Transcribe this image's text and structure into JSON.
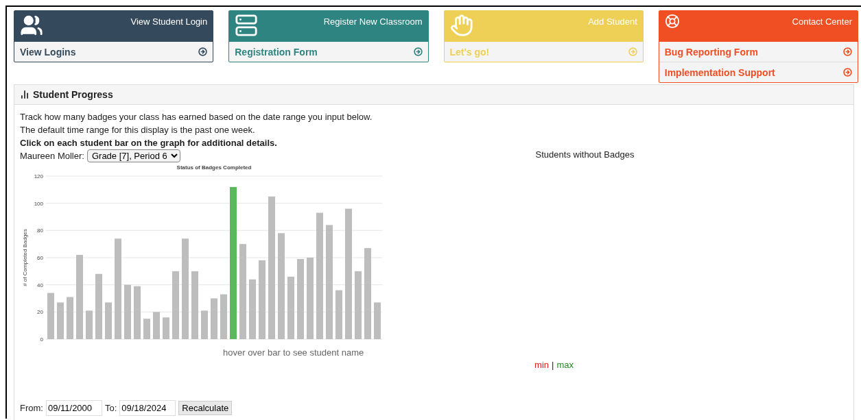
{
  "cards": [
    {
      "title": "View Student Login",
      "color": "#344a5c",
      "links": [
        "View Logins"
      ]
    },
    {
      "title": "Register New Classroom",
      "color": "#2e8480",
      "links": [
        "Registration Form"
      ]
    },
    {
      "title": "Add Student",
      "color": "#eed056",
      "links": [
        "Let's go!"
      ]
    },
    {
      "title": "Contact Center",
      "color": "#f04e23",
      "links": [
        "Bug Reporting Form",
        "Implementation Support"
      ]
    }
  ],
  "panel": {
    "title": "Student Progress",
    "intro": [
      "Track how many badges your class has earned based on the date range you input below.",
      "The default time range for this display is the past one week."
    ],
    "instruction": "Click on each student bar on the graph for additional details.",
    "teacher_label": "Maureen Moller:",
    "class_select": "Grade [7], Period 6",
    "chart_data": {
      "type": "bar",
      "title": "Status of Badges Completed",
      "ylabel": "# of Completed Badges",
      "ylim": [
        0,
        120
      ],
      "yticks": [
        0,
        20,
        40,
        60,
        80,
        100,
        120
      ],
      "grid": true,
      "series": [
        {
          "color": "#bdbdbd",
          "values": [
            34,
            27,
            31,
            62,
            21,
            48,
            27,
            74,
            40,
            39,
            15,
            20,
            16,
            50,
            74,
            50,
            21,
            30,
            33,
            null,
            70,
            44,
            58,
            105,
            78,
            46,
            59,
            60,
            93,
            84,
            36,
            96,
            50,
            67,
            27
          ]
        },
        {
          "color": "#5cb85c",
          "values": [
            null,
            null,
            null,
            null,
            null,
            null,
            null,
            null,
            null,
            null,
            null,
            null,
            null,
            null,
            null,
            null,
            null,
            null,
            null,
            112,
            null,
            null,
            null,
            null,
            null,
            null,
            null,
            null,
            null,
            null,
            null,
            null,
            null,
            null,
            null
          ]
        }
      ]
    },
    "hover_hint": "hover over bar to see student name",
    "side_title": "Students without Badges",
    "legend": {
      "min": "min",
      "separator": "|",
      "max": "max"
    },
    "from_label": "From:",
    "from_value": "09/11/2000",
    "to_label": "To:",
    "to_value": "09/18/2024",
    "button": "Recalculate"
  }
}
